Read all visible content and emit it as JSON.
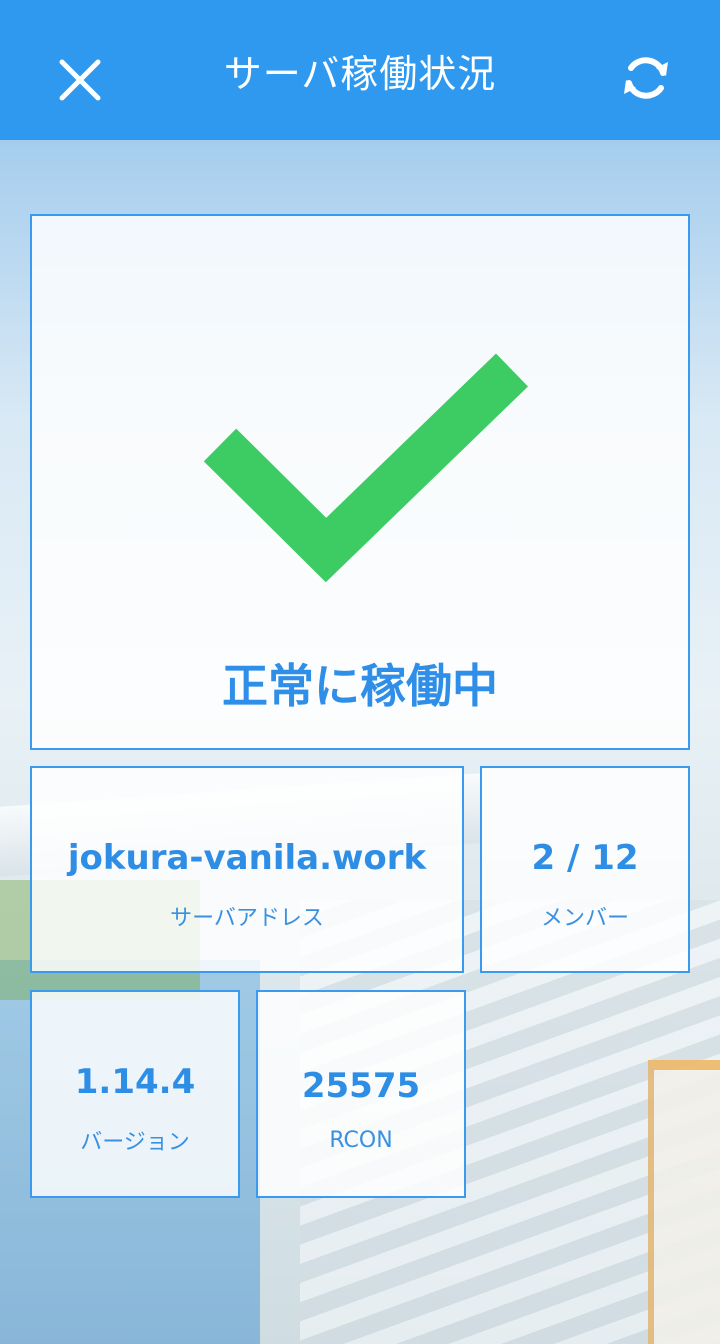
{
  "header": {
    "title": "サーバ稼働状況",
    "close_icon": "close-icon",
    "refresh_icon": "refresh-icon"
  },
  "status": {
    "icon": "check-icon",
    "text": "正常に稼働中",
    "color": "#3ccc63"
  },
  "info": {
    "address": {
      "value": "jokura-vanila.work",
      "label": "サーバアドレス"
    },
    "members": {
      "value": "2 / 12",
      "label": "メンバー"
    },
    "version": {
      "value": "1.14.4",
      "label": "バージョン"
    },
    "rcon": {
      "value": "25575",
      "label": "RCON"
    }
  },
  "colors": {
    "header": "#2f99f0",
    "accent": "#2e8ee6",
    "check": "#3ccc63"
  }
}
